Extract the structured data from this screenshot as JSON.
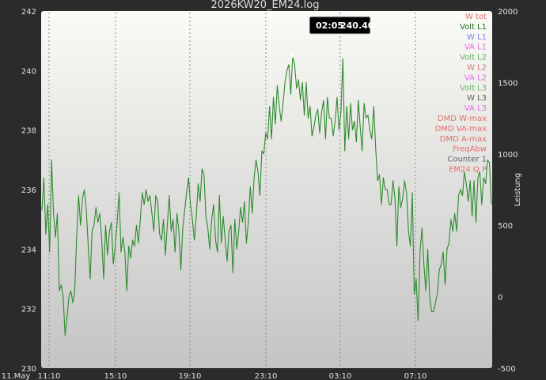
{
  "chart_data": {
    "type": "line",
    "title": "2026KW20_EM24.log",
    "ylabel_right": "Leistung",
    "ylim": [
      230,
      242
    ],
    "y_ticks": [
      "230",
      "232",
      "234",
      "236",
      "238",
      "240",
      "242"
    ],
    "y2lim": [
      -500,
      2000
    ],
    "y2_ticks": [
      "-500",
      "0",
      "500",
      "1000",
      "1500",
      "2000"
    ],
    "x_ticks": [
      "11.May",
      "11:10",
      "15:10",
      "19:10",
      "23:10",
      "03:10",
      "07:10"
    ],
    "tooltip": {
      "time": "02:05",
      "value": "240.40"
    },
    "legend": [
      {
        "label": "W tot",
        "color": "#e07070"
      },
      {
        "label": "Volt L1",
        "color": "#1f6f1f"
      },
      {
        "label": "W L1",
        "color": "#8080f0"
      },
      {
        "label": "VA L1",
        "color": "#e070e0"
      },
      {
        "label": "Volt L2",
        "color": "#60b060"
      },
      {
        "label": "W L2",
        "color": "#d07878"
      },
      {
        "label": "VA L2",
        "color": "#e070e0"
      },
      {
        "label": "Volt L3",
        "color": "#70b870"
      },
      {
        "label": "W L3",
        "color": "#606060"
      },
      {
        "label": "VA L3",
        "color": "#e070e0"
      },
      {
        "label": "DMD W-max",
        "color": "#e07070"
      },
      {
        "label": "DMD VA-max",
        "color": "#e07070"
      },
      {
        "label": "DMD A-max",
        "color": "#e07070"
      },
      {
        "label": "FreqAbw",
        "color": "#e07070"
      },
      {
        "label": "Counter 1",
        "color": "#606060"
      },
      {
        "label": "EM24 Q P",
        "color": "#e07070"
      }
    ],
    "series": [
      {
        "name": "Volt L1",
        "color": "#2e8b2e",
        "values": [
          235.3,
          236.4,
          234.5,
          235.5,
          233.9,
          237.0,
          235.2,
          234.4,
          235.2,
          232.6,
          232.8,
          232.4,
          231.1,
          231.7,
          232.4,
          232.6,
          232.2,
          232.6,
          234.4,
          235.8,
          234.8,
          235.7,
          236.0,
          235.3,
          234.1,
          233.0,
          234.6,
          234.8,
          235.4,
          234.9,
          235.2,
          234.3,
          233.0,
          234.8,
          233.8,
          234.6,
          234.9,
          233.5,
          234.1,
          234.9,
          235.9,
          233.9,
          234.4,
          233.9,
          232.6,
          234.1,
          233.7,
          234.3,
          234.1,
          234.8,
          234.2,
          235.0,
          235.9,
          235.5,
          236.0,
          235.6,
          235.8,
          235.2,
          234.6,
          235.8,
          235.6,
          234.5,
          234.3,
          235.0,
          233.8,
          234.8,
          235.8,
          234.6,
          235.0,
          233.9,
          235.2,
          234.6,
          233.3,
          234.7,
          235.3,
          235.9,
          236.4,
          235.5,
          235.0,
          234.3,
          235.1,
          236.2,
          235.6,
          236.7,
          236.5,
          235.1,
          234.7,
          234.0,
          235.0,
          235.5,
          234.3,
          233.9,
          235.8,
          234.2,
          235.1,
          234.3,
          233.6,
          234.6,
          234.8,
          233.2,
          235.0,
          234.0,
          234.6,
          235.4,
          234.9,
          235.6,
          234.2,
          234.9,
          236.1,
          235.2,
          236.4,
          237.0,
          236.6,
          235.8,
          237.3,
          237.2,
          237.9,
          237.7,
          238.8,
          237.7,
          239.1,
          238.2,
          239.5,
          238.8,
          238.3,
          238.9,
          239.6,
          240.0,
          240.2,
          239.2,
          240.5,
          240.2,
          239.4,
          239.7,
          239.0,
          239.6,
          238.5,
          239.6,
          238.4,
          238.8,
          237.8,
          238.1,
          238.5,
          238.7,
          237.9,
          238.6,
          239.0,
          237.7,
          239.1,
          238.4,
          238.4,
          237.8,
          238.3,
          239.1,
          238.0,
          238.6,
          240.4,
          237.3,
          238.8,
          237.7,
          238.9,
          238.0,
          238.3,
          237.6,
          239.0,
          238.1,
          237.3,
          238.9,
          238.4,
          238.5,
          238.0,
          237.7,
          238.8,
          237.4,
          236.3,
          236.5,
          235.5,
          236.4,
          236.0,
          236.0,
          235.5,
          235.5,
          236.3,
          235.7,
          234.1,
          236.1,
          235.4,
          235.7,
          236.3,
          235.9,
          234.6,
          234.1,
          235.9,
          232.5,
          233.0,
          231.6,
          233.9,
          234.7,
          233.5,
          232.6,
          234.0,
          232.4,
          231.9,
          231.9,
          232.2,
          232.5,
          233.3,
          233.5,
          233.9,
          232.8,
          234.0,
          234.2,
          235.0,
          234.6,
          235.2,
          234.6,
          235.8,
          236.0,
          235.8,
          236.6,
          236.2,
          235.6,
          236.3,
          235.1,
          236.3,
          234.9,
          236.4,
          236.6,
          235.5,
          236.4,
          236.2,
          237.0,
          236.9,
          235.5
        ]
      }
    ]
  }
}
